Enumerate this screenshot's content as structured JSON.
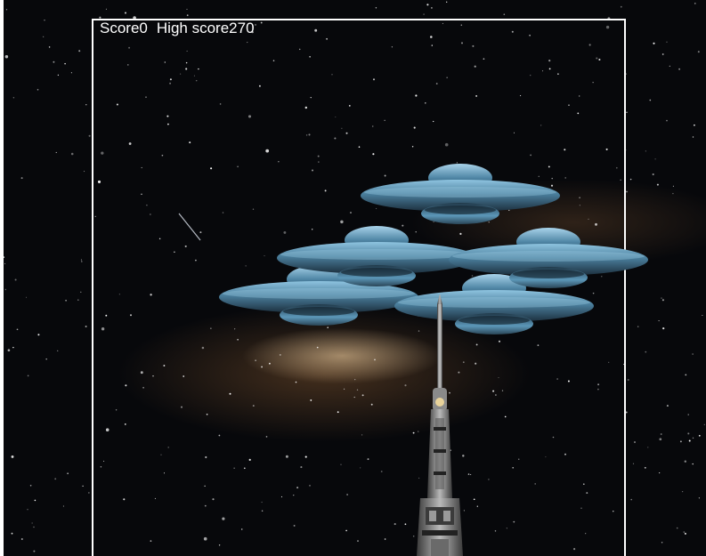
{
  "hud": {
    "score_label": "Score",
    "score_value": "0",
    "high_score_label": "High score",
    "high_score_value": "270"
  },
  "scene": {
    "enemy_count": 5,
    "enemy_type": "ufo-icon",
    "player_type": "spaceship-icon",
    "colors": {
      "frame": "#ffffff",
      "hud_text": "#ffffff",
      "space": "#07080b",
      "ufo_body": "#6fa8c8"
    }
  }
}
